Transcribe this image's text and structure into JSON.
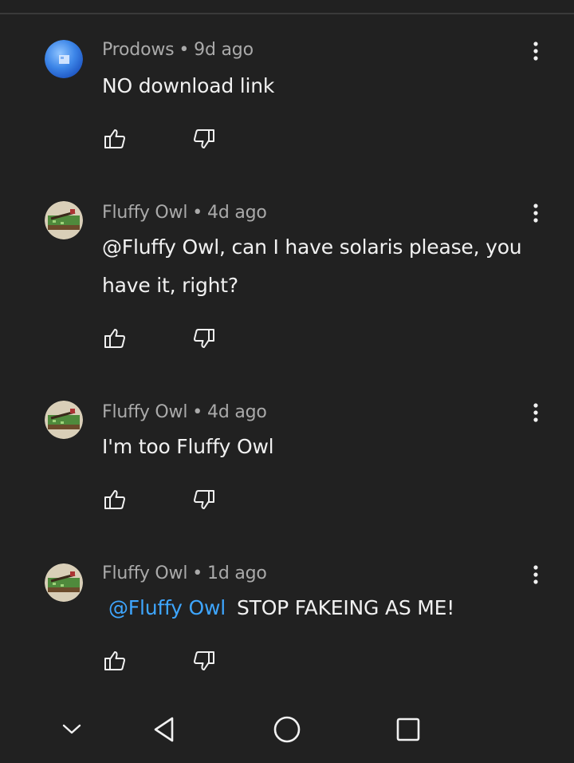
{
  "comments": [
    {
      "author": "Prodows",
      "time": "9d ago",
      "text": "NO download link"
    },
    {
      "author": "Fluffy Owl",
      "time": "4d ago",
      "text_line1": "@Fluffy Owl, can I have solaris please, you",
      "text_line2": "have it, right?"
    },
    {
      "author": "Fluffy Owl",
      "time": "4d ago",
      "text": "I'm too Fluffy Owl"
    },
    {
      "author": "Fluffy Owl",
      "time": "1d ago",
      "mention": "@Fluffy Owl",
      "text": "STOP FAKEING AS ME!"
    }
  ],
  "separator": "•",
  "colors": {
    "background": "#212121",
    "text": "#f1f1f1",
    "meta": "#aaaaaa",
    "mention": "#3ea6ff"
  },
  "icons": {
    "more": "more-vert-icon",
    "like": "thumbs-up-icon",
    "dislike": "thumbs-down-icon",
    "nav_collapse": "chevron-down-icon",
    "nav_back": "back-triangle-icon",
    "nav_home": "home-circle-icon",
    "nav_recents": "recents-square-icon"
  }
}
